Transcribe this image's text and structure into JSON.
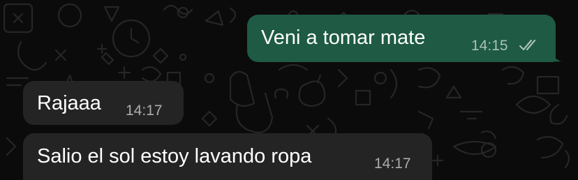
{
  "colors": {
    "background": "#0b0b0b",
    "outgoing_bubble": "#1e5a44",
    "incoming_bubble": "#242424",
    "text": "#ffffff",
    "timestamp": "#b0b7b3",
    "wallpaper_doodles": "#262626"
  },
  "chat": {
    "messages": [
      {
        "direction": "outgoing",
        "text": "Veni a tomar mate",
        "time": "14:15",
        "status_icon": "double-check-icon"
      },
      {
        "direction": "incoming",
        "text": "Rajaaa",
        "time": "14:17"
      },
      {
        "direction": "incoming",
        "text": "Salio el sol estoy lavando ropa",
        "time": "14:17"
      }
    ]
  }
}
